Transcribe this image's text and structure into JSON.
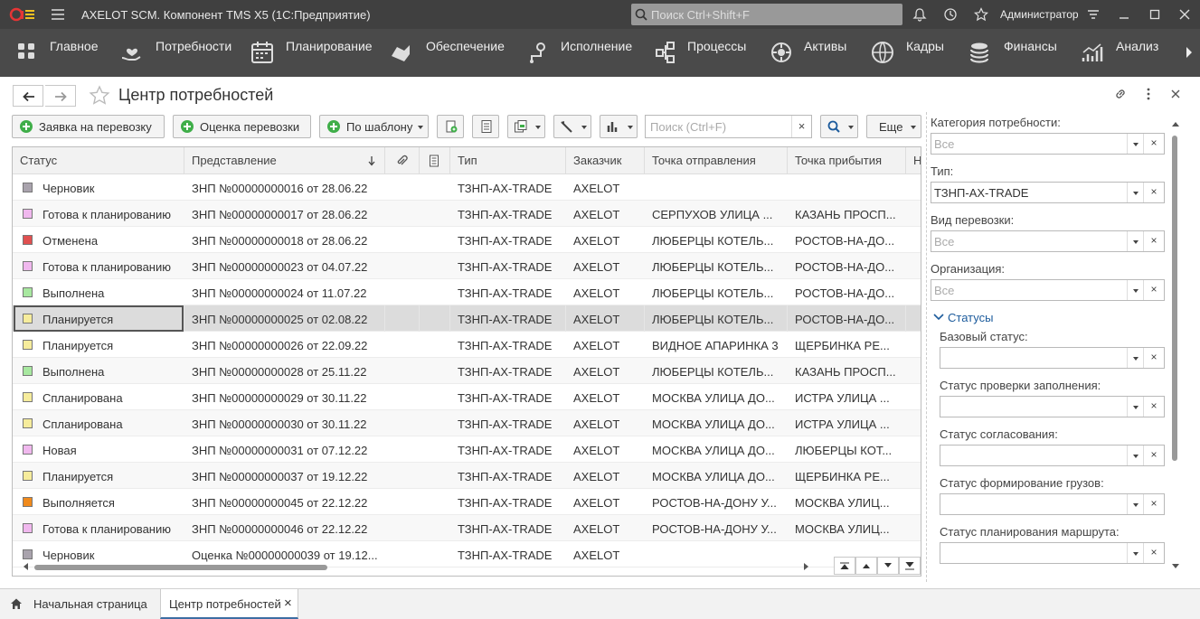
{
  "app": {
    "logo": "1C",
    "title": "AXELOT SCM. Компонент TMS X5  (1С:Предприятие)",
    "search_placeholder": "Поиск Ctrl+Shift+F",
    "user": "Администратор"
  },
  "sections": [
    {
      "label": "Главное",
      "icon": "grid-icon"
    },
    {
      "label": "Потребности",
      "icon": "heart-hand-icon"
    },
    {
      "label": "Планирование",
      "icon": "calendar-icon"
    },
    {
      "label": "Обеспечение",
      "icon": "truck-icon"
    },
    {
      "label": "Исполнение",
      "icon": "route-icon"
    },
    {
      "label": "Процессы",
      "icon": "process-icon"
    },
    {
      "label": "Активы",
      "icon": "assets-icon"
    },
    {
      "label": "Кадры",
      "icon": "staff-icon"
    },
    {
      "label": "Финансы",
      "icon": "coins-icon"
    },
    {
      "label": "Анализ",
      "icon": "analysis-icon"
    }
  ],
  "form": {
    "title": "Центр потребностей"
  },
  "toolbar": {
    "transport_request": "Заявка на перевозку",
    "transport_estimate": "Оценка перевозки",
    "by_template": "По шаблону",
    "search_placeholder": "Поиск (Ctrl+F)",
    "search_clear": "×",
    "more": "Еще"
  },
  "grid": {
    "columns": [
      "Статус",
      "Представление",
      "",
      "",
      "Тип",
      "Заказчик",
      "Точка отправления",
      "Точка прибытия",
      "Н"
    ],
    "rows": [
      {
        "status": "Черновик",
        "color": "#a9a3ad",
        "repr": "ЗНП №00000000016 от 28.06.22",
        "type": "ТЗНП-АХ-TRADE",
        "customer": "AXELOT",
        "from": "",
        "to": ""
      },
      {
        "status": "Готова к планированию",
        "color": "#f0b8ee",
        "repr": "ЗНП №00000000017 от 28.06.22",
        "type": "ТЗНП-АХ-TRADE",
        "customer": "AXELOT",
        "from": "СЕРПУХОВ УЛИЦА ...",
        "to": "КАЗАНЬ ПРОСП..."
      },
      {
        "status": "Отменена",
        "color": "#e05050",
        "repr": "ЗНП №00000000018 от 28.06.22",
        "type": "ТЗНП-АХ-TRADE",
        "customer": "AXELOT",
        "from": "ЛЮБЕРЦЫ КОТЕЛЬ...",
        "to": "РОСТОВ-НА-ДО..."
      },
      {
        "status": "Готова к планированию",
        "color": "#f0b8ee",
        "repr": "ЗНП №00000000023 от 04.07.22",
        "type": "ТЗНП-АХ-TRADE",
        "customer": "AXELOT",
        "from": "ЛЮБЕРЦЫ КОТЕЛЬ...",
        "to": "РОСТОВ-НА-ДО..."
      },
      {
        "status": "Выполнена",
        "color": "#a8e8a0",
        "repr": "ЗНП №00000000024 от 11.07.22",
        "type": "ТЗНП-АХ-TRADE",
        "customer": "AXELOT",
        "from": "ЛЮБЕРЦЫ КОТЕЛЬ...",
        "to": "РОСТОВ-НА-ДО..."
      },
      {
        "status": "Планируется",
        "color": "#f6ec9c",
        "repr": "ЗНП №00000000025 от 02.08.22",
        "type": "ТЗНП-АХ-TRADE",
        "customer": "AXELOT",
        "from": "ЛЮБЕРЦЫ КОТЕЛЬ...",
        "to": "РОСТОВ-НА-ДО..."
      },
      {
        "status": "Планируется",
        "color": "#f6ec9c",
        "repr": "ЗНП №00000000026 от 22.09.22",
        "type": "ТЗНП-АХ-TRADE",
        "customer": "AXELOT",
        "from": "ВИДНОЕ АПАРИНКА 3",
        "to": "ЩЕРБИНКА РЕ..."
      },
      {
        "status": "Выполнена",
        "color": "#a8e8a0",
        "repr": "ЗНП №00000000028 от 25.11.22",
        "type": "ТЗНП-АХ-TRADE",
        "customer": "AXELOT",
        "from": "ЛЮБЕРЦЫ КОТЕЛЬ...",
        "to": "КАЗАНЬ ПРОСП..."
      },
      {
        "status": "Спланирована",
        "color": "#f6ec9c",
        "repr": "ЗНП №00000000029 от 30.11.22",
        "type": "ТЗНП-АХ-TRADE",
        "customer": "AXELOT",
        "from": "МОСКВА УЛИЦА ДО...",
        "to": "ИСТРА УЛИЦА ..."
      },
      {
        "status": "Спланирована",
        "color": "#f6ec9c",
        "repr": "ЗНП №00000000030 от 30.11.22",
        "type": "ТЗНП-АХ-TRADE",
        "customer": "AXELOT",
        "from": "МОСКВА УЛИЦА ДО...",
        "to": "ИСТРА УЛИЦА ..."
      },
      {
        "status": "Новая",
        "color": "#f0b8ee",
        "repr": "ЗНП №00000000031 от 07.12.22",
        "type": "ТЗНП-АХ-TRADE",
        "customer": "AXELOT",
        "from": "МОСКВА УЛИЦА ДО...",
        "to": "ЛЮБЕРЦЫ КОТ..."
      },
      {
        "status": "Планируется",
        "color": "#f6ec9c",
        "repr": "ЗНП №00000000037 от 19.12.22",
        "type": "ТЗНП-АХ-TRADE",
        "customer": "AXELOT",
        "from": "МОСКВА УЛИЦА ДО...",
        "to": "ЩЕРБИНКА РЕ..."
      },
      {
        "status": "Выполняется",
        "color": "#f08a1c",
        "repr": "ЗНП №00000000045 от 22.12.22",
        "type": "ТЗНП-АХ-TRADE",
        "customer": "AXELOT",
        "from": "РОСТОВ-НА-ДОНУ У...",
        "to": "МОСКВА УЛИЦ..."
      },
      {
        "status": "Готова к планированию",
        "color": "#f0b8ee",
        "repr": "ЗНП №00000000046 от 22.12.22",
        "type": "ТЗНП-АХ-TRADE",
        "customer": "AXELOT",
        "from": "РОСТОВ-НА-ДОНУ У...",
        "to": "МОСКВА УЛИЦ..."
      },
      {
        "status": "Черновик",
        "color": "#a9a3ad",
        "repr": "Оценка №00000000039 от 19.12...",
        "type": "ТЗНП-АХ-TRADE",
        "customer": "AXELOT",
        "from": "",
        "to": ""
      }
    ],
    "selected_row": 5
  },
  "filters": {
    "category_label": "Категория потребности:",
    "category_value": "Все",
    "type_label": "Тип:",
    "type_value": "ТЗНП-АХ-TRADE",
    "transport_label": "Вид перевозки:",
    "transport_value": "Все",
    "org_label": "Организация:",
    "org_value": "Все",
    "group_title": "Статусы",
    "base_status_label": "Базовый статус:",
    "fill_check_label": "Статус проверки заполнения:",
    "approval_label": "Статус согласования:",
    "cargo_label": "Статус формирование грузов:",
    "route_label": "Статус планирования маршрута:",
    "clear": "×"
  },
  "tabs": {
    "home": "Начальная страница",
    "current": "Центр потребностей",
    "close": "×"
  },
  "colors": {
    "accent": "#3fae49",
    "header_bg": "#404040",
    "sections_bg": "#4a4a4a",
    "link": "#1c5b9c"
  }
}
